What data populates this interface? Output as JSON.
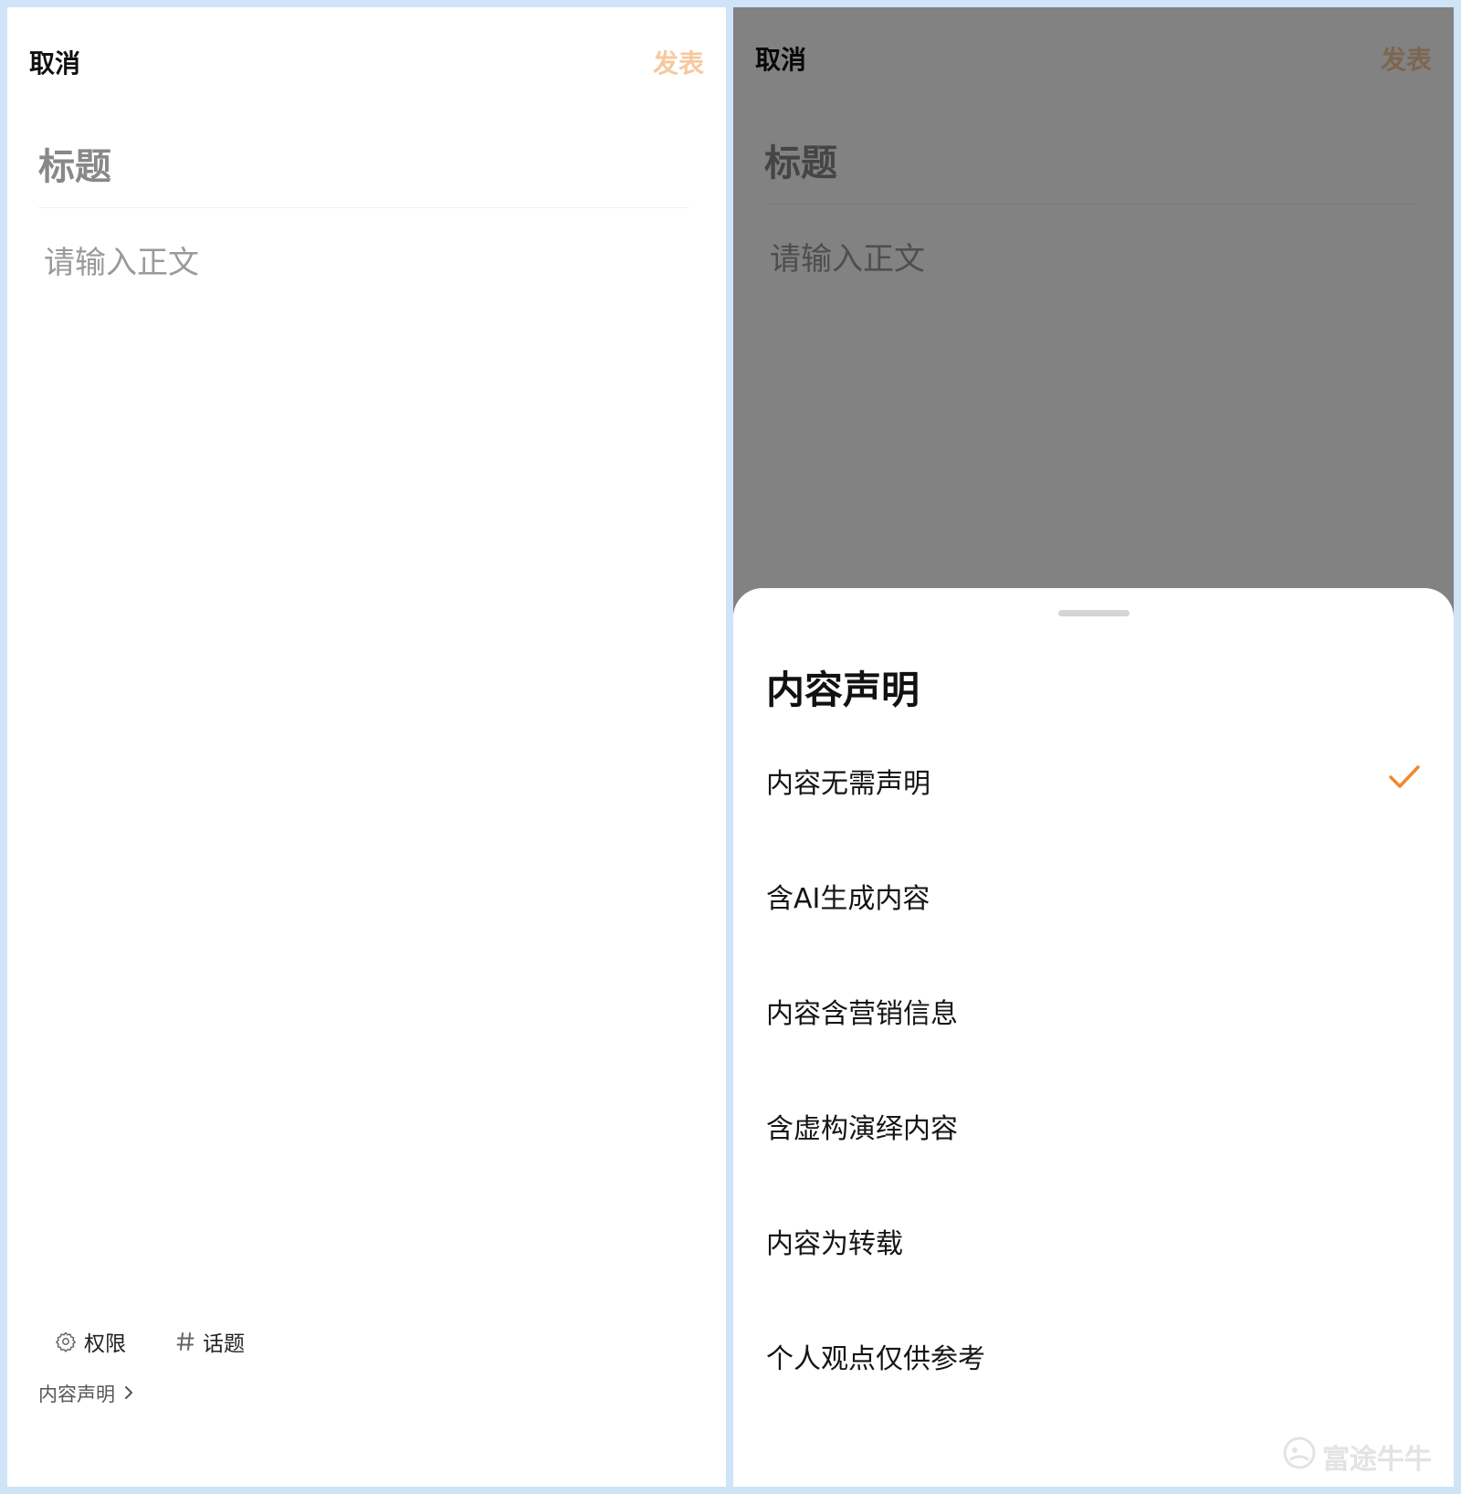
{
  "left": {
    "header": {
      "cancel_label": "取消",
      "publish_label": "发表"
    },
    "editor": {
      "title_placeholder": "标题",
      "body_placeholder": "请输入正文"
    },
    "toolbar": {
      "permission_label": "权限",
      "topic_label": "话题"
    },
    "declaration_link": "内容声明"
  },
  "right": {
    "header": {
      "cancel_label": "取消",
      "publish_label": "发表"
    },
    "editor": {
      "title_placeholder": "标题",
      "body_placeholder": "请输入正文"
    },
    "sheet": {
      "title": "内容声明",
      "options": [
        {
          "label": "内容无需声明",
          "selected": true
        },
        {
          "label": "含AI生成内容",
          "selected": false
        },
        {
          "label": "内容含营销信息",
          "selected": false
        },
        {
          "label": "含虚构演绎内容",
          "selected": false
        },
        {
          "label": "内容为转载",
          "selected": false
        },
        {
          "label": "个人观点仅供参考",
          "selected": false
        }
      ]
    },
    "watermark": "富途牛牛"
  },
  "colors": {
    "accent": "#f0882e",
    "publish_disabled": "#f6c99e",
    "background_frame": "#cfe5f7"
  }
}
